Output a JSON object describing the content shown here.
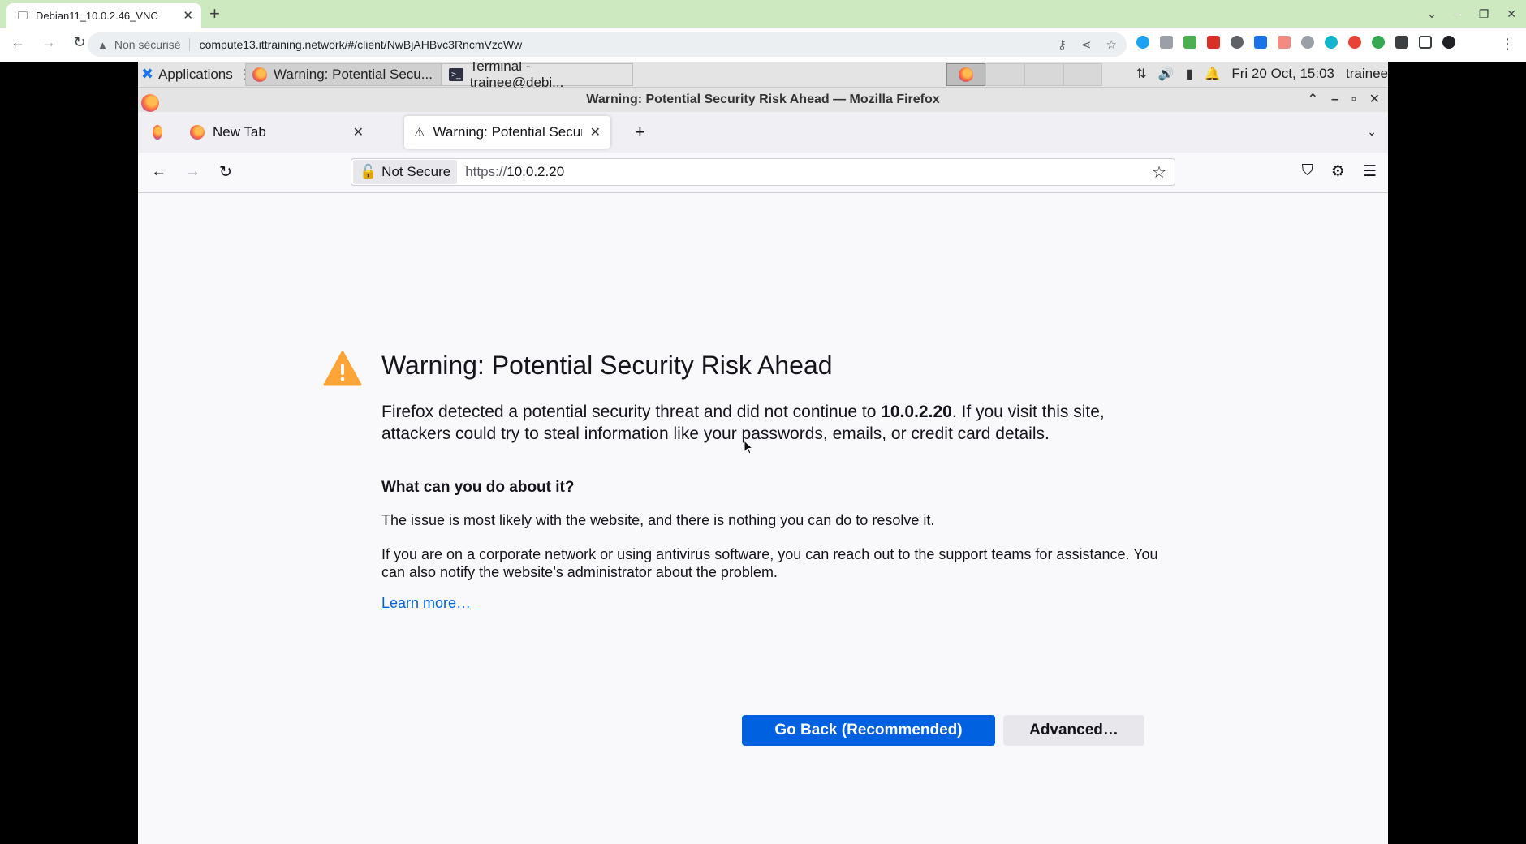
{
  "host_browser": {
    "tab_title": "Debian11_10.0.2.46_VNC",
    "insecure_label": "Non sécurisé",
    "url": "compute13.ittraining.network/#/client/NwBjAHBvc3RncmVzcWw"
  },
  "xfce_panel": {
    "apps_label": "Applications",
    "tasks": [
      {
        "label": "Warning: Potential Secu..."
      },
      {
        "label": "Terminal - trainee@debi..."
      }
    ],
    "clock": "Fri 20 Oct, 15:03",
    "user": "trainee"
  },
  "firefox": {
    "window_title": "Warning: Potential Security Risk Ahead — Mozilla Firefox",
    "tabs": [
      {
        "label": "New Tab"
      },
      {
        "label": "Warning: Potential Securi"
      }
    ],
    "urlbar": {
      "security_label": "Not Secure",
      "url_prefix": "https://",
      "url_host": "10.0.2.20"
    }
  },
  "error_page": {
    "title": "Warning: Potential Security Risk Ahead",
    "body_prefix": "Firefox detected a potential security threat and did not continue to ",
    "body_host": "10.0.2.20",
    "body_suffix": ". If you visit this site, attackers could try to steal information like your passwords, emails, or credit card details.",
    "heading": "What can you do about it?",
    "para1": "The issue is most likely with the website, and there is nothing you can do to resolve it.",
    "para2": "If you are on a corporate network or using antivirus software, you can reach out to the support teams for assistance. You can also notify the website’s administrator about the problem.",
    "learn_more": "Learn more…",
    "go_back_label": "Go Back (Recommended)",
    "advanced_label": "Advanced…"
  },
  "colors": {
    "primary_button": "#0061e0",
    "warning_icon": "#ffa436",
    "host_tabbar": "#cde9c0"
  }
}
